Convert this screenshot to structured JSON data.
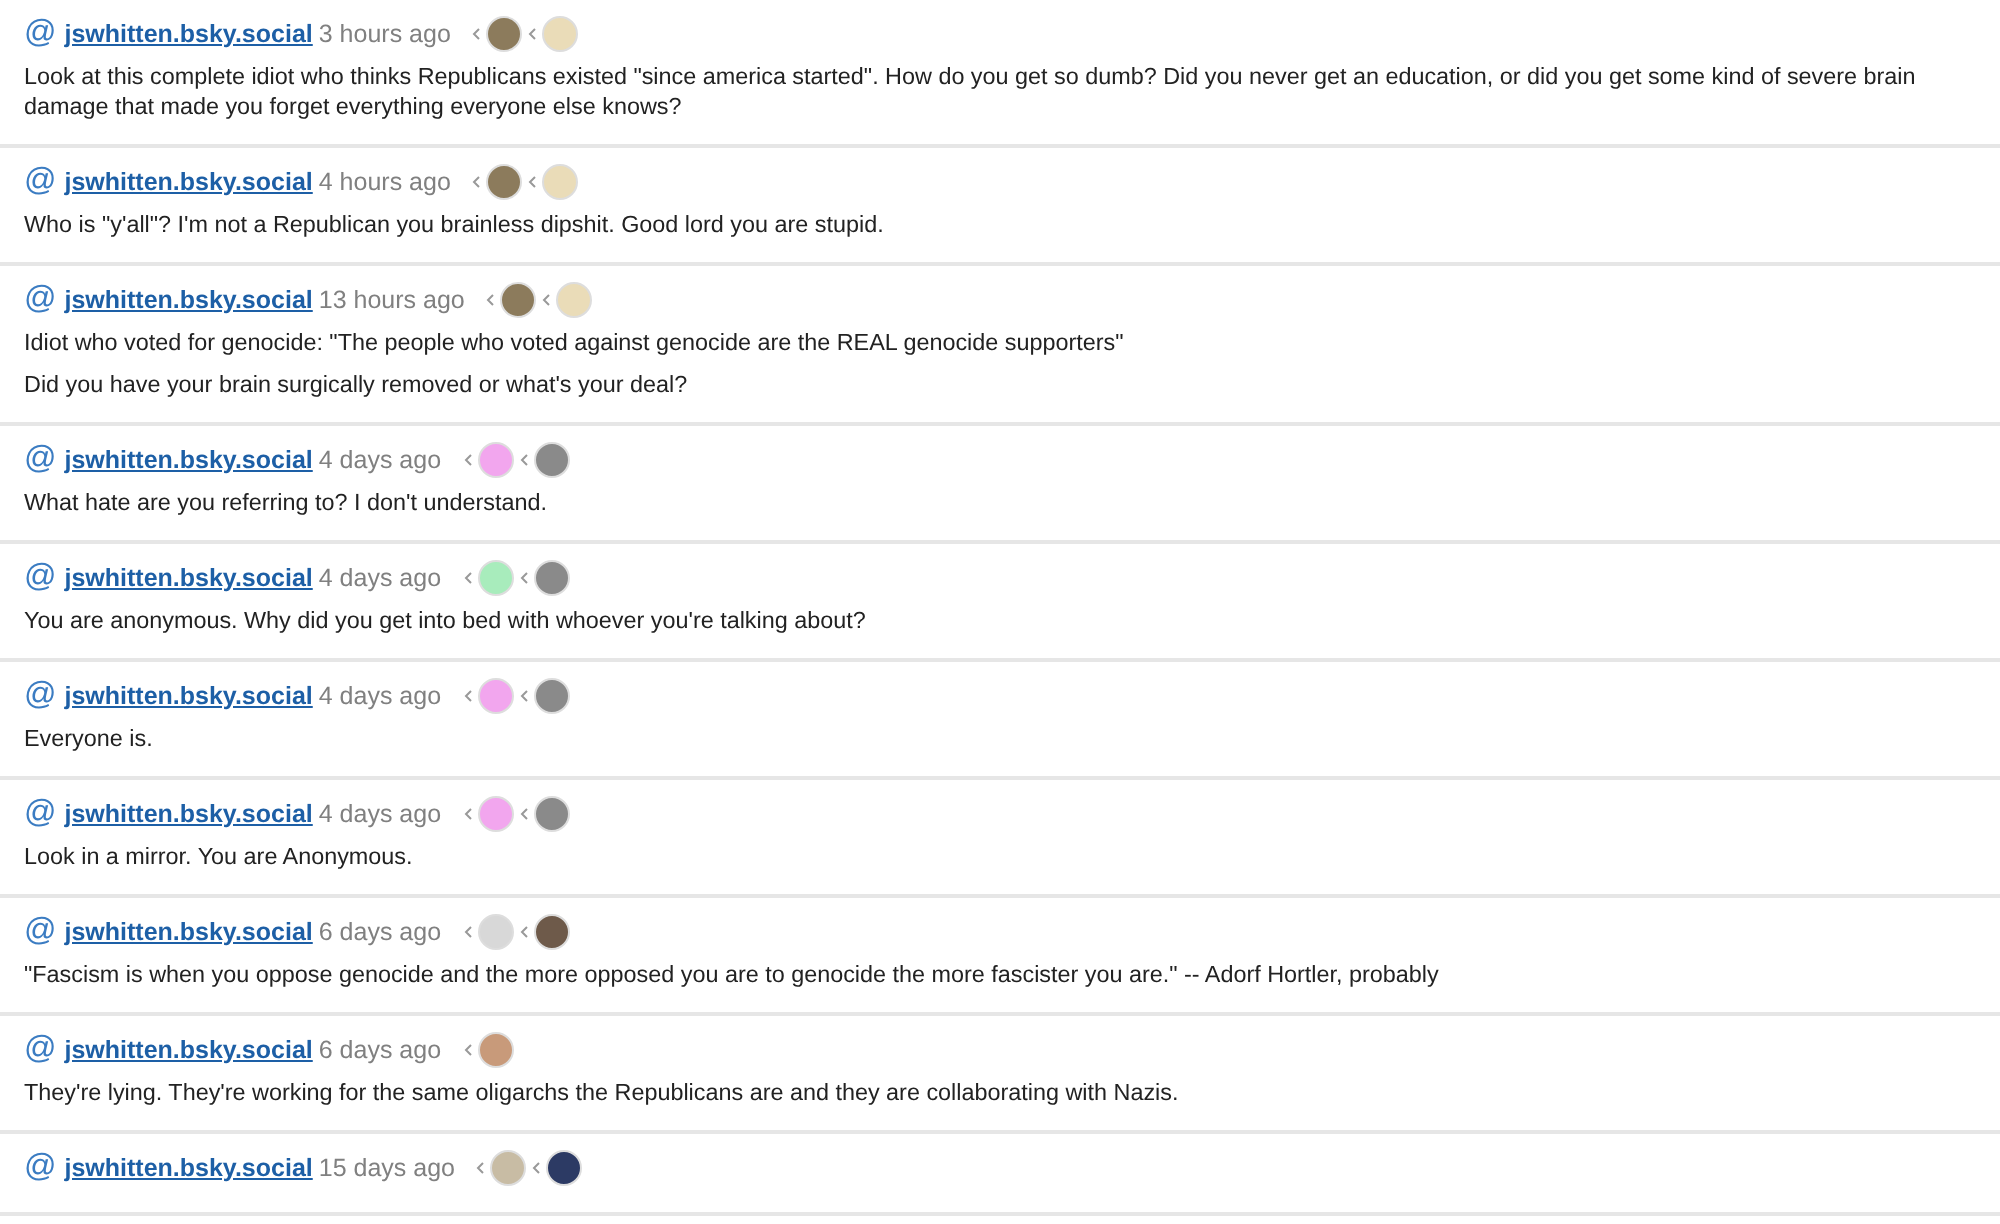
{
  "posts": [
    {
      "at": "@",
      "handle": "jswhitten.bsky.social",
      "time": "3 hours ago",
      "avatars": [
        {
          "color": "#8c7b5c"
        },
        {
          "color": "#eadcb8"
        }
      ],
      "paragraphs": [
        "Look at this complete idiot who thinks Republicans existed \"since america started\". How do you get so dumb? Did you never get an education, or did you get some kind of severe brain damage that made you forget everything everyone else knows?"
      ]
    },
    {
      "at": "@",
      "handle": "jswhitten.bsky.social",
      "time": "4 hours ago",
      "avatars": [
        {
          "color": "#8c7b5c"
        },
        {
          "color": "#eadcb8"
        }
      ],
      "paragraphs": [
        "Who is \"y'all\"? I'm not a Republican you brainless dipshit. Good lord you are stupid."
      ]
    },
    {
      "at": "@",
      "handle": "jswhitten.bsky.social",
      "time": "13 hours ago",
      "avatars": [
        {
          "color": "#8c7b5c"
        },
        {
          "color": "#eadcb8"
        }
      ],
      "paragraphs": [
        "Idiot who voted for genocide: \"The people who voted against genocide are the REAL genocide supporters\"",
        "Did you have your brain surgically removed or what's your deal?"
      ]
    },
    {
      "at": "@",
      "handle": "jswhitten.bsky.social",
      "time": "4 days ago",
      "avatars": [
        {
          "color": "#f2a6ee"
        },
        {
          "color": "#8a8a8a"
        }
      ],
      "paragraphs": [
        "What hate are you referring to? I don't understand."
      ]
    },
    {
      "at": "@",
      "handle": "jswhitten.bsky.social",
      "time": "4 days ago",
      "avatars": [
        {
          "color": "#a8ecbc"
        },
        {
          "color": "#8a8a8a"
        }
      ],
      "paragraphs": [
        "You are anonymous. Why did you get into bed with whoever you're talking about?"
      ]
    },
    {
      "at": "@",
      "handle": "jswhitten.bsky.social",
      "time": "4 days ago",
      "avatars": [
        {
          "color": "#f2a6ee"
        },
        {
          "color": "#8a8a8a"
        }
      ],
      "paragraphs": [
        "Everyone is."
      ]
    },
    {
      "at": "@",
      "handle": "jswhitten.bsky.social",
      "time": "4 days ago",
      "avatars": [
        {
          "color": "#f2a6ee"
        },
        {
          "color": "#8a8a8a"
        }
      ],
      "paragraphs": [
        "Look in a mirror. You are Anonymous."
      ]
    },
    {
      "at": "@",
      "handle": "jswhitten.bsky.social",
      "time": "6 days ago",
      "avatars": [
        {
          "color": "#d8d8d8"
        },
        {
          "color": "#6e5a4a"
        }
      ],
      "paragraphs": [
        "\"Fascism is when you oppose genocide and the more opposed you are to genocide the more fascister you are.\" -- Adorf Hortler, probably"
      ]
    },
    {
      "at": "@",
      "handle": "jswhitten.bsky.social",
      "time": "6 days ago",
      "avatars": [
        {
          "color": "#c89a7a"
        }
      ],
      "paragraphs": [
        "They're lying. They're working for the same oligarchs the Republicans are and they are collaborating with Nazis."
      ]
    },
    {
      "at": "@",
      "handle": "jswhitten.bsky.social",
      "time": "15 days ago",
      "avatars": [
        {
          "color": "#c8bca4"
        },
        {
          "color": "#2c3a64"
        }
      ]
    }
  ]
}
